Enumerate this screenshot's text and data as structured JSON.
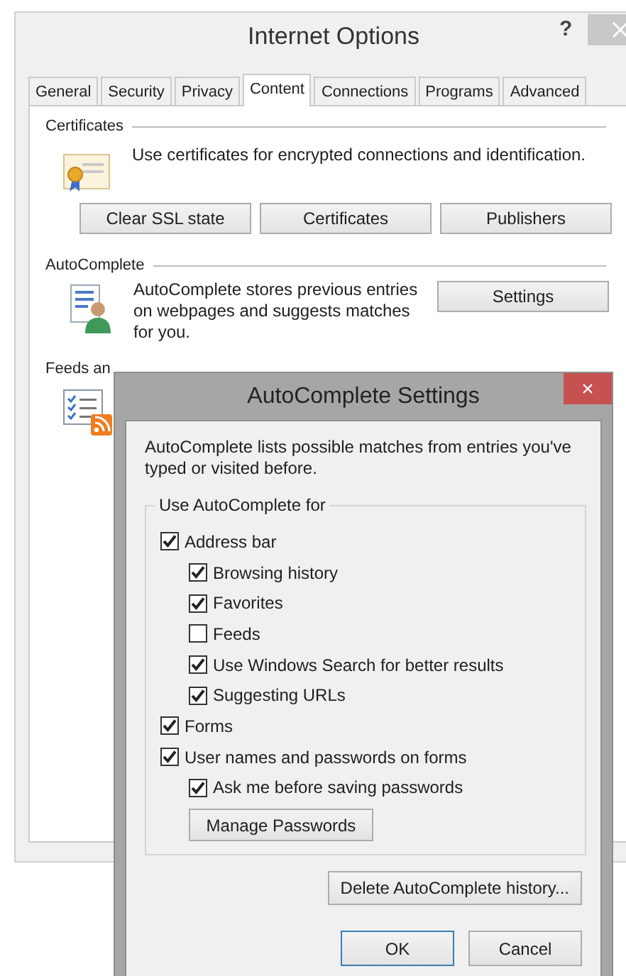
{
  "window": {
    "title": "Internet Options",
    "help": "?"
  },
  "tabs": [
    {
      "label": "General",
      "selected": false
    },
    {
      "label": "Security",
      "selected": false
    },
    {
      "label": "Privacy",
      "selected": false
    },
    {
      "label": "Content",
      "selected": true
    },
    {
      "label": "Connections",
      "selected": false
    },
    {
      "label": "Programs",
      "selected": false
    },
    {
      "label": "Advanced",
      "selected": false
    }
  ],
  "certificates": {
    "heading": "Certificates",
    "description": "Use certificates for encrypted connections and identification.",
    "buttons": [
      "Clear SSL state",
      "Certificates",
      "Publishers"
    ]
  },
  "autocomplete": {
    "heading": "AutoComplete",
    "description": "AutoComplete stores previous entries on webpages and suggests matches for you.",
    "button": "Settings"
  },
  "feeds": {
    "heading": "Feeds an"
  },
  "dialog": {
    "title": "AutoComplete Settings",
    "close": "×",
    "intro": "AutoComplete lists possible matches from entries you've typed or visited before.",
    "group": "Use AutoComplete for",
    "options": [
      {
        "label": "Address bar",
        "checked": true,
        "children": [
          {
            "label": "Browsing history",
            "checked": true
          },
          {
            "label": "Favorites",
            "checked": true
          },
          {
            "label": "Feeds",
            "checked": false
          },
          {
            "label": "Use Windows Search for better results",
            "checked": true
          },
          {
            "label": "Suggesting URLs",
            "checked": true
          }
        ]
      },
      {
        "label": "Forms",
        "checked": true
      },
      {
        "label": "User names and passwords on forms",
        "checked": true,
        "children": [
          {
            "label": "Ask me before saving passwords",
            "checked": true
          }
        ]
      }
    ],
    "manage_button": "Manage Passwords",
    "delete_button": "Delete AutoComplete history...",
    "ok": "OK",
    "cancel": "Cancel"
  }
}
